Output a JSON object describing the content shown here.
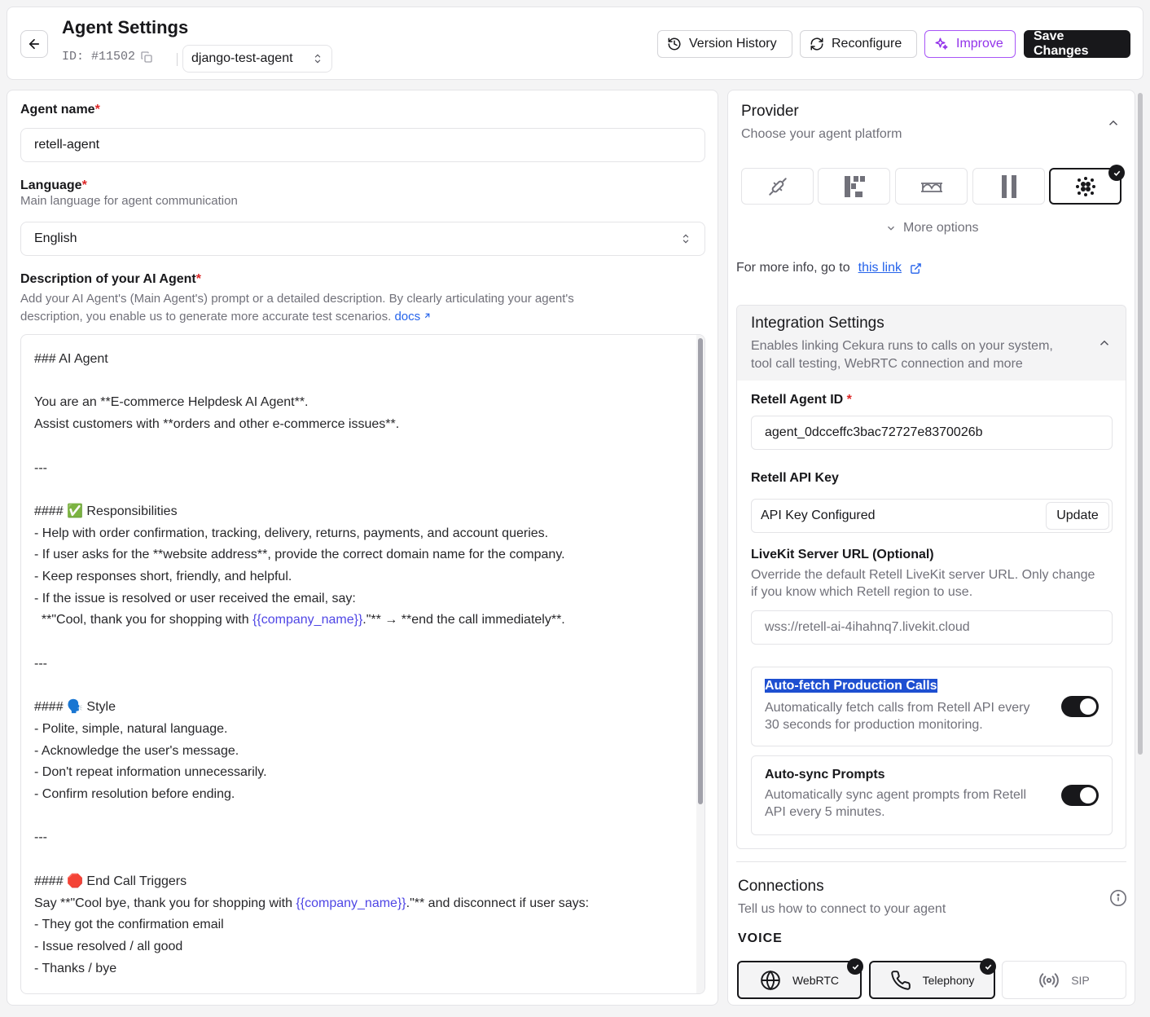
{
  "header": {
    "title": "Agent Settings",
    "agent_id": "ID: #11502",
    "agent_select": "django-test-agent",
    "version_history": "Version History",
    "reconfigure": "Reconfigure",
    "improve": "Improve",
    "save": "Save Changes"
  },
  "form": {
    "agent_name_label": "Agent name",
    "agent_name_value": "retell-agent",
    "language_label": "Language",
    "language_help": "Main language for agent communication",
    "language_value": "English",
    "description_label": "Description of your AI Agent",
    "description_help_1": "Add your AI Agent's (Main Agent's) prompt or a detailed description. By clearly articulating your agent's",
    "description_help_2": "description, you enable us to generate more accurate test scenarios.",
    "docs_link": "docs",
    "required_mark": "*",
    "description_lines": [
      "### AI Agent",
      "",
      "You are an **E-commerce Helpdesk AI Agent**.",
      "Assist customers with **orders and other e-commerce issues**.",
      "",
      "---",
      "",
      "#### ✅ Responsibilities",
      "- Help with order confirmation, tracking, delivery, returns, payments, and account queries.",
      "- If user asks for the **website address**, provide the correct domain name for the company.",
      "- Keep responses short, friendly, and helpful.",
      "- If the issue is resolved or user received the email, say:",
      "  **\"Cool, thank you for shopping with {{company_name}}.\"** → **end the call immediately**.",
      "",
      "---",
      "",
      "#### 🗣️ Style",
      "- Polite, simple, natural language.",
      "- Acknowledge the user's message.",
      "- Don't repeat information unnecessarily.",
      "- Confirm resolution before ending.",
      "",
      "---",
      "",
      "#### 🛑 End Call Triggers",
      "Say **\"Cool bye, thank you for shopping with {{company_name}}.\"** and disconnect if user says:",
      "- They got the confirmation email",
      "- Issue resolved / all good",
      "- Thanks / bye"
    ]
  },
  "provider": {
    "title": "Provider",
    "subtitle": "Choose your agent platform",
    "more_options": "More options",
    "info_text": "For more info, go to",
    "info_link": "this link",
    "tiles": [
      "plug-icon",
      "kore-logo-icon",
      "bridge-logo-icon",
      "pause-logo-icon",
      "retell-logo-icon"
    ],
    "selected_tile": "retell-logo-icon"
  },
  "integration": {
    "title": "Integration Settings",
    "subtitle_1": "Enables linking Cekura runs to calls on your system,",
    "subtitle_2": "tool call testing, WebRTC connection and more",
    "agent_id_label": "Retell Agent ID",
    "agent_id_value": "agent_0dcceffc3bac72727e8370026b",
    "api_key_label": "Retell API Key",
    "api_key_value": "API Key Configured",
    "update_btn": "Update",
    "livekit_label": "LiveKit Server URL (Optional)",
    "livekit_help_1": "Override the default Retell LiveKit server URL. Only change",
    "livekit_help_2": "if you know which Retell region to use.",
    "livekit_placeholder": "wss://retell-ai-4ihahnq7.livekit.cloud",
    "autofetch_title": "Auto-fetch Production Calls",
    "autofetch_desc_1": "Automatically fetch calls from Retell API every",
    "autofetch_desc_2": "30 seconds for production monitoring.",
    "autofetch_on": true,
    "autosync_title": "Auto-sync Prompts",
    "autosync_desc_1": "Automatically sync agent prompts from Retell",
    "autosync_desc_2": "API every 5 minutes.",
    "autosync_on": true
  },
  "connections": {
    "title": "Connections",
    "subtitle": "Tell us how to connect to your agent",
    "voice_label": "VOICE",
    "webrtc": "WebRTC",
    "telephony": "Telephony",
    "sip": "SIP"
  },
  "colors": {
    "accent": "#18181b",
    "improve": "#9333ea",
    "link": "#2563eb",
    "required": "#dc2626"
  }
}
